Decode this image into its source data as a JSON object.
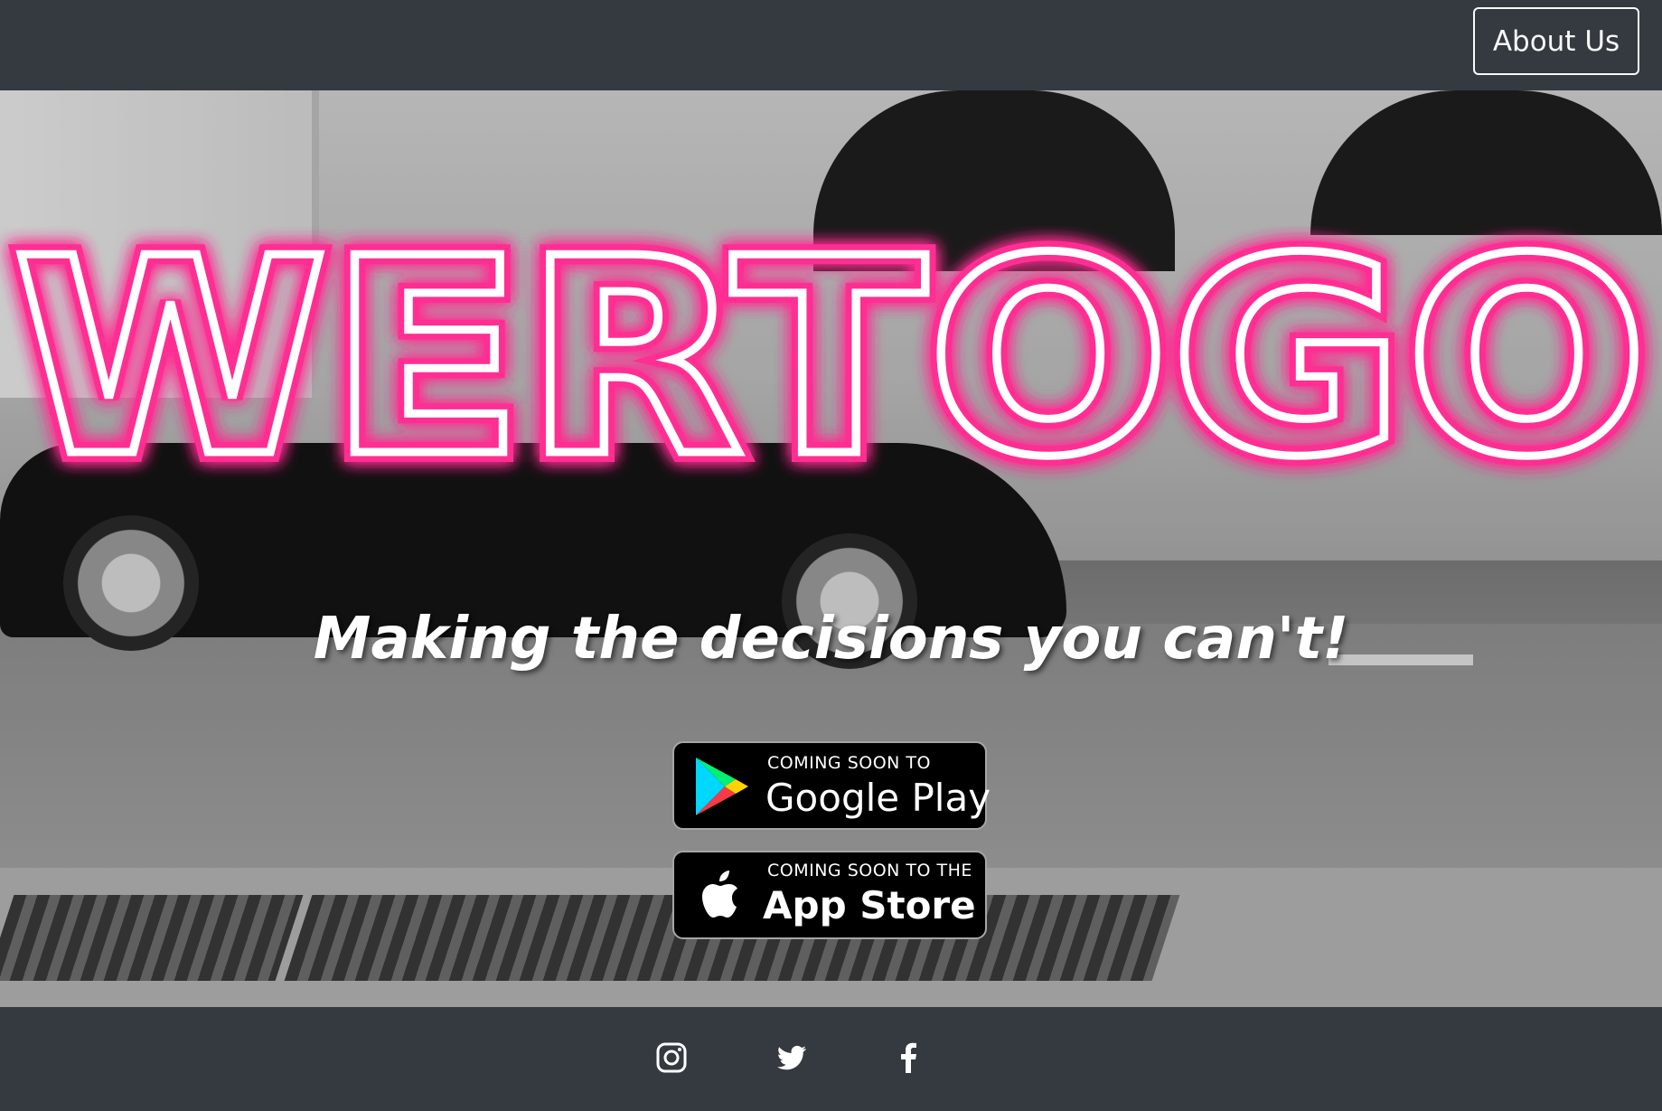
{
  "navbar": {
    "about_label": "About Us"
  },
  "hero": {
    "logo_text": "WERTOGO",
    "tagline": "Making the decisions you can't!",
    "logo_color": "#ff2f92"
  },
  "badges": {
    "google": {
      "small": "COMING SOON TO",
      "big": "Google Play",
      "icon": "google-play-icon"
    },
    "apple": {
      "small": "COMING SOON TO THE",
      "big": "App Store",
      "icon": "apple-icon"
    }
  },
  "footer": {
    "social": [
      {
        "icon": "instagram-icon"
      },
      {
        "icon": "twitter-icon"
      },
      {
        "icon": "facebook-icon"
      }
    ]
  }
}
